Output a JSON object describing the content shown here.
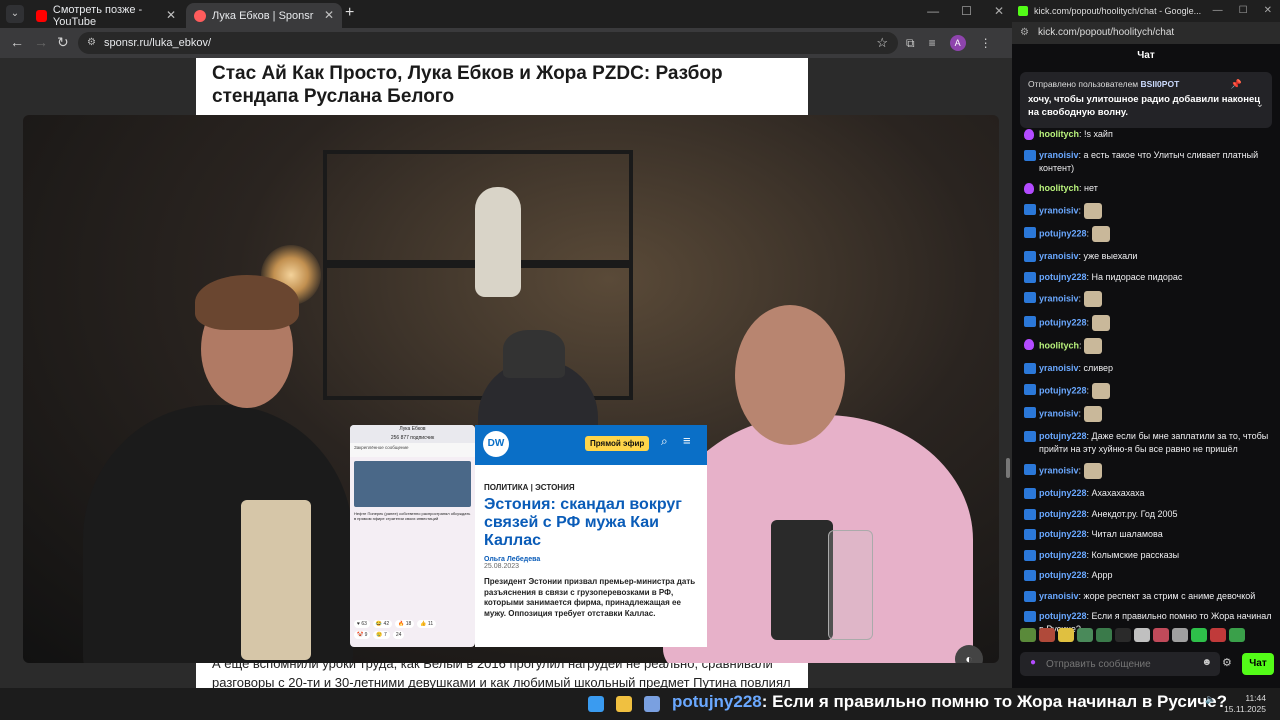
{
  "browser": {
    "tabs": [
      {
        "label": "Смотреть позже - YouTube",
        "color": "#ff0000"
      },
      {
        "label": "Лука Ебков | Sponsr",
        "color": "#ff5c5c"
      }
    ],
    "url": "sponsr.ru/luka_ebkov/",
    "avatar": "A"
  },
  "page": {
    "title": "Стас Ай Как Просто, Лука Ебков и Жора PZDC: Разбор стендапа Руслана Белого",
    "text": "А еще вспомнили уроки труда, как Белый в 2016 прогулил нагрудей не реально, сравнивали разговоры с 20-ти и 30-летними девушками и как любимый школьный предмет Путина повлиял"
  },
  "video": {
    "tg": {
      "channel": "Лука Ебков",
      "subscribers": "256 877 подписчик",
      "pinned": "Закреплённое сообщение",
      "text": "Нефте Поперек (ранее) собственно распространял обсуждать в прямом эфире стратегии своих инвестиций",
      "reactions": [
        "♥ 63",
        "😂 42",
        "🔥 18",
        "👍 11",
        "🤡 9",
        "😢 7",
        "24"
      ]
    },
    "dw": {
      "logo": "DW",
      "live": "Прямой эфир",
      "rubric": "ПОЛИТИКА | ЭСТОНИЯ",
      "headline": "Эстония: скандал вокруг связей с РФ мужа Каи Каллас",
      "author": "Ольга Лебедева",
      "date": "25.08.2023",
      "lede": "Президент Эстонии призвал премьер-министра дать разъяснения в связи с грузоперевозками в РФ, которыми занимается фирма, принадлежащая ее мужу. Оппозиция требует отставки Каллас."
    }
  },
  "chatwin": {
    "title": "kick.com/popout/hoolitych/chat - Google...",
    "url": "kick.com/popout/hoolitych/chat",
    "header": "Чат",
    "pinned": {
      "by_label": "Отправлено пользователем",
      "by_user": "BSII0POT",
      "message": "хочу, чтобы улитошное радио добавили наконец на свободную волну."
    },
    "messages": [
      {
        "user": "hoolitych",
        "color": "#b9f27c",
        "badge": "mic",
        "text": "!s хайп"
      },
      {
        "user": "yranoisiv",
        "color": "#6aa8ff",
        "badge": "sub",
        "text": "а есть такое что Улитыч сливает платный контент)"
      },
      {
        "user": "hoolitych",
        "color": "#b9f27c",
        "badge": "mic",
        "text": "нет"
      },
      {
        "user": "yranoisiv",
        "color": "#6aa8ff",
        "badge": "sub",
        "text": "",
        "emote": true
      },
      {
        "user": "potujny228",
        "color": "#6aa8ff",
        "badge": "sub",
        "text": "",
        "emote": true
      },
      {
        "user": "yranoisiv",
        "color": "#6aa8ff",
        "badge": "sub",
        "text": "уже выехали"
      },
      {
        "user": "potujny228",
        "color": "#6aa8ff",
        "badge": "sub",
        "text": "На пидорасе пидорас"
      },
      {
        "user": "yranoisiv",
        "color": "#6aa8ff",
        "badge": "sub",
        "text": "",
        "emote": true
      },
      {
        "user": "potujny228",
        "color": "#6aa8ff",
        "badge": "sub",
        "text": "",
        "emote": true
      },
      {
        "user": "hoolitych",
        "color": "#b9f27c",
        "badge": "mic",
        "text": "",
        "emote": true
      },
      {
        "user": "yranoisiv",
        "color": "#6aa8ff",
        "badge": "sub",
        "text": "сливер"
      },
      {
        "user": "potujny228",
        "color": "#6aa8ff",
        "badge": "sub",
        "text": "",
        "emote": true
      },
      {
        "user": "yranoisiv",
        "color": "#6aa8ff",
        "badge": "sub",
        "text": "",
        "emote": true
      },
      {
        "user": "potujny228",
        "color": "#6aa8ff",
        "badge": "sub",
        "text": "Даже если бы мне заплатили за то, чтобы прийти на эту хуйню-я бы все равно не пришёл"
      },
      {
        "user": "yranoisiv",
        "color": "#6aa8ff",
        "badge": "sub",
        "text": "",
        "emote": true
      },
      {
        "user": "potujny228",
        "color": "#6aa8ff",
        "badge": "sub",
        "text": "Ахахахахаха"
      },
      {
        "user": "potujny228",
        "color": "#6aa8ff",
        "badge": "sub",
        "text": "Анекдот.ру. Год 2005"
      },
      {
        "user": "potujny228",
        "color": "#6aa8ff",
        "badge": "sub",
        "text": "Читал шаламова"
      },
      {
        "user": "potujny228",
        "color": "#6aa8ff",
        "badge": "sub",
        "text": "Колымские рассказы"
      },
      {
        "user": "potujny228",
        "color": "#6aa8ff",
        "badge": "sub",
        "text": "Аррр"
      },
      {
        "user": "yranoisiv",
        "color": "#6aa8ff",
        "badge": "sub",
        "text": "жоре респект за стрим с аниме девочкой"
      },
      {
        "user": "potujny228",
        "color": "#6aa8ff",
        "badge": "sub",
        "text": "Если я правильно помню то Жора начинал в Русиче?"
      }
    ],
    "input_placeholder": "Отправить сообщение",
    "send_label": "Чат"
  },
  "taskbar": {
    "ticker_user": "potujny228",
    "ticker_text": ": Если я правильно помню то Жора начинал в Русиче?",
    "time": "11:44",
    "date": "15.11.2025"
  }
}
